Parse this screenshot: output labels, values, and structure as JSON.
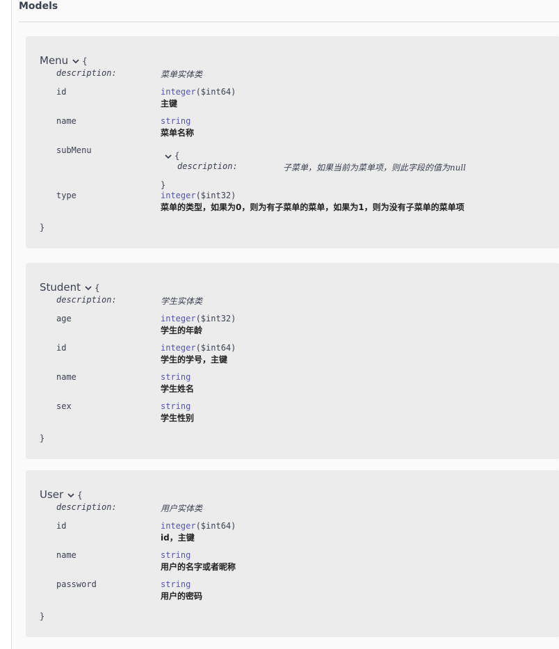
{
  "section": {
    "title": "Models"
  },
  "models": [
    {
      "name": "Menu",
      "open_brace": "{",
      "close_brace": "}",
      "description_key": "description:",
      "description": "菜单实体类",
      "properties": [
        {
          "name": "id",
          "type": "integer",
          "format": "($int64)",
          "desc": "主键"
        },
        {
          "name": "name",
          "type": "string",
          "format": "",
          "desc": "菜单名称"
        },
        {
          "name": "subMenu",
          "nested": {
            "open_brace": "{",
            "description_key": "description:",
            "description": "子菜单，如果当前为菜单项，则此字段的值为null",
            "close_brace": "}"
          }
        },
        {
          "name": "type",
          "type": "integer",
          "format": "($int32)",
          "desc": "菜单的类型，如果为0，则为有子菜单的菜单，如果为1，则为没有子菜单的菜单项"
        }
      ]
    },
    {
      "name": "Student",
      "open_brace": "{",
      "close_brace": "}",
      "description_key": "description:",
      "description": "学生实体类",
      "properties": [
        {
          "name": "age",
          "type": "integer",
          "format": "($int32)",
          "desc": "学生的年龄"
        },
        {
          "name": "id",
          "type": "integer",
          "format": "($int64)",
          "desc": "学生的学号，主键"
        },
        {
          "name": "name",
          "type": "string",
          "format": "",
          "desc": "学生姓名"
        },
        {
          "name": "sex",
          "type": "string",
          "format": "",
          "desc": "学生性别"
        }
      ]
    },
    {
      "name": "User",
      "open_brace": "{",
      "close_brace": "}",
      "description_key": "description:",
      "description": "用户实体类",
      "properties": [
        {
          "name": "id",
          "type": "integer",
          "format": "($int64)",
          "desc": "id，主键"
        },
        {
          "name": "name",
          "type": "string",
          "format": "",
          "desc": "用户的名字或者昵称"
        },
        {
          "name": "password",
          "type": "string",
          "format": "",
          "desc": "用户的密码"
        }
      ]
    }
  ]
}
